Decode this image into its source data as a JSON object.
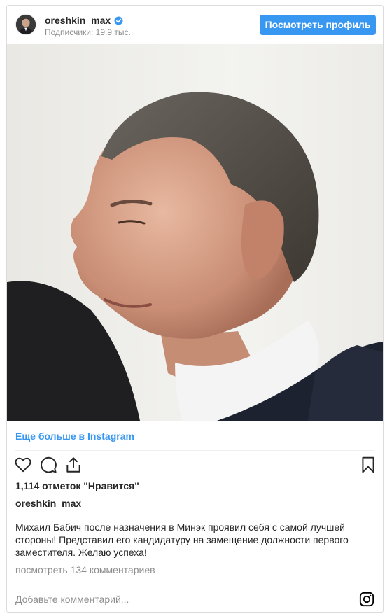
{
  "header": {
    "username": "oreshkin_max",
    "verified": true,
    "followers": "Подписчики: 19.9 тыс.",
    "view_profile_label": "Посмотреть профиль"
  },
  "photo": {
    "description_icon": "portrait-photo"
  },
  "more_link": "Еще больше в Instagram",
  "actions": {
    "icons": [
      "heart-icon",
      "comment-icon",
      "share-icon",
      "bookmark-icon"
    ]
  },
  "likes": "1,114 отметок \"Нравится\"",
  "author": "oreshkin_max",
  "caption": "Михаил Бабич после назначения в Минэк проявил себя с самой лучшей стороны! Представил его кандидатуру на замещение должности первого заместителя. Желаю успеха!",
  "comments_link": "посмотреть 134 комментариев",
  "comment_input": {
    "placeholder": "Добавьте комментарий..."
  },
  "colors": {
    "accent": "#3897f0",
    "muted": "#8e8e8e",
    "text": "#262626",
    "border": "#dbdbdb"
  }
}
